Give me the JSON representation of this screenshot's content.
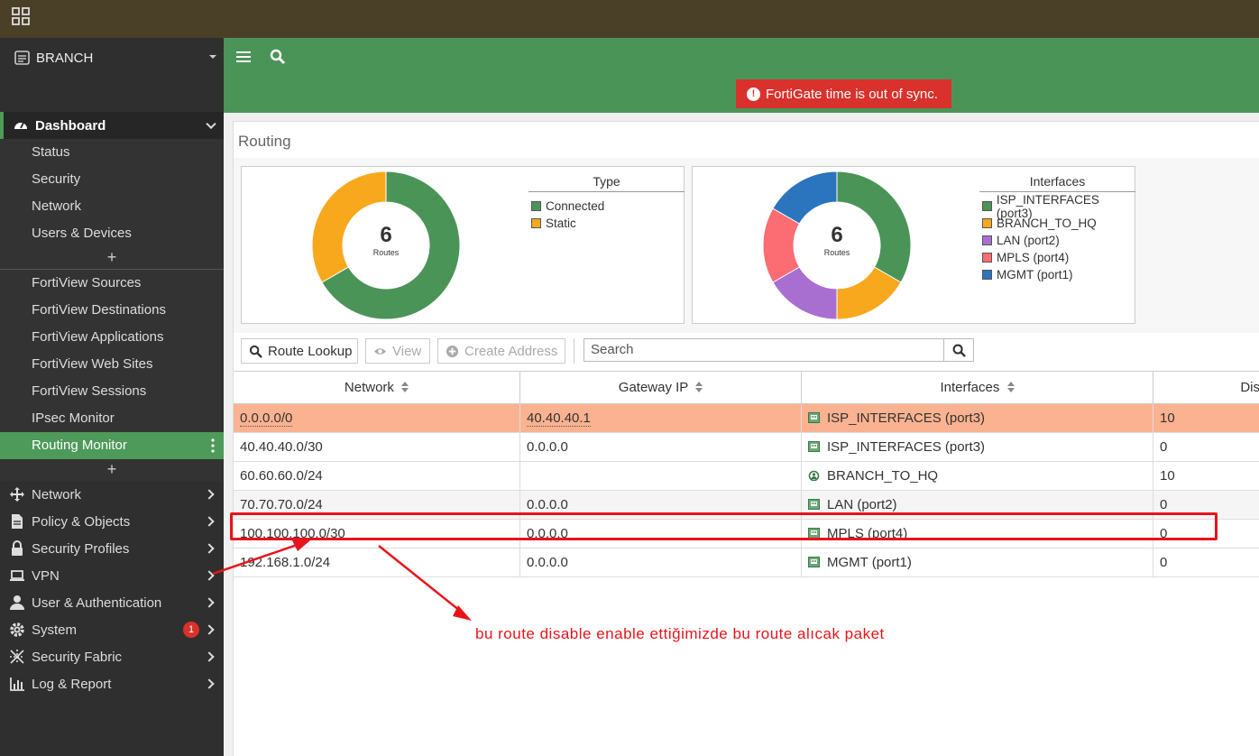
{
  "device": {
    "name": "BRANCH"
  },
  "sidebar": {
    "dashboard": {
      "label": "Dashboard",
      "items": [
        "Status",
        "Security",
        "Network",
        "Users & Devices"
      ],
      "fortiview": [
        "FortiView Sources",
        "FortiView Destinations",
        "FortiView Applications",
        "FortiView Web Sites",
        "FortiView Sessions",
        "IPsec Monitor",
        "Routing Monitor"
      ],
      "active": "Routing Monitor"
    },
    "plus": "+",
    "nav": [
      {
        "label": "Network",
        "icon": "move-arrows-icon"
      },
      {
        "label": "Policy & Objects",
        "icon": "document-icon"
      },
      {
        "label": "Security Profiles",
        "icon": "lock-icon"
      },
      {
        "label": "VPN",
        "icon": "laptop-icon"
      },
      {
        "label": "User & Authentication",
        "icon": "user-icon"
      },
      {
        "label": "System",
        "icon": "gear-icon",
        "badge": "1"
      },
      {
        "label": "Security Fabric",
        "icon": "fabric-icon"
      },
      {
        "label": "Log & Report",
        "icon": "bar-chart-icon"
      }
    ]
  },
  "header": {
    "alert": "FortiGate time is out of sync."
  },
  "page": {
    "title": "Routing"
  },
  "widgets": {
    "type": {
      "total": "6",
      "unit": "Routes",
      "legend_title": "Type",
      "items": [
        {
          "label": "Connected",
          "value": 4,
          "color": "#4b9458"
        },
        {
          "label": "Static",
          "value": 2,
          "color": "#f8a81c"
        }
      ]
    },
    "interfaces": {
      "total": "6",
      "unit": "Routes",
      "legend_title": "Interfaces",
      "items": [
        {
          "label": "ISP_INTERFACES (port3)",
          "value": 2,
          "color": "#4b9458"
        },
        {
          "label": "BRANCH_TO_HQ",
          "value": 1,
          "color": "#f8a81c"
        },
        {
          "label": "LAN (port2)",
          "value": 1,
          "color": "#a86fd1"
        },
        {
          "label": "MPLS (port4)",
          "value": 1,
          "color": "#fb6c73"
        },
        {
          "label": "MGMT (port1)",
          "value": 1,
          "color": "#2b74be"
        }
      ]
    }
  },
  "toolbar": {
    "route_lookup": "Route Lookup",
    "view": "View",
    "create_address": "Create Address",
    "search_placeholder": "Search"
  },
  "table": {
    "columns": [
      "Network",
      "Gateway IP",
      "Interfaces",
      "Dis"
    ],
    "rows": [
      {
        "network": "0.0.0.0/0",
        "gateway": "40.40.40.1",
        "interface": "ISP_INTERFACES (port3)",
        "distance": "10",
        "iface_icon": "port-icon"
      },
      {
        "network": "40.40.40.0/30",
        "gateway": "0.0.0.0",
        "interface": "ISP_INTERFACES (port3)",
        "distance": "0",
        "iface_icon": "port-icon"
      },
      {
        "network": "60.60.60.0/24",
        "gateway": "",
        "interface": "BRANCH_TO_HQ",
        "distance": "10",
        "iface_icon": "tunnel-icon"
      },
      {
        "network": "70.70.70.0/24",
        "gateway": "0.0.0.0",
        "interface": "LAN (port2)",
        "distance": "0",
        "iface_icon": "port-icon"
      },
      {
        "network": "100.100.100.0/30",
        "gateway": "0.0.0.0",
        "interface": "MPLS (port4)",
        "distance": "0",
        "iface_icon": "port-icon"
      },
      {
        "network": "192.168.1.0/24",
        "gateway": "0.0.0.0",
        "interface": "MGMT (port1)",
        "distance": "0",
        "iface_icon": "port-icon"
      }
    ]
  },
  "annotation": {
    "text": "bu route disable enable ettiğimizde bu route alıcak paket",
    "color": "#e8141b"
  }
}
